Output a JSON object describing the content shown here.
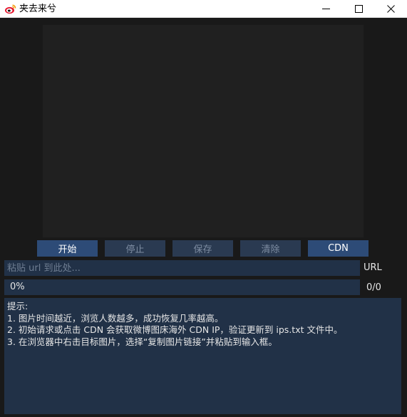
{
  "window": {
    "title": "夹去来兮",
    "icon": "weibo-logo-icon",
    "controls": {
      "minimize": "minimize-icon",
      "maximize": "maximize-icon",
      "close": "close-icon"
    }
  },
  "buttons": {
    "start": "开始",
    "stop": "停止",
    "save": "保存",
    "clear": "清除",
    "cdn": "CDN"
  },
  "url_input": {
    "value": "",
    "placeholder": "粘贴 url 到此处...",
    "label": "URL"
  },
  "progress": {
    "percent_text": "0%",
    "fraction": 0,
    "count": "0/0"
  },
  "tips": {
    "heading": "提示:",
    "lines": [
      "1. 图片时间越近，浏览人数越多，成功恢复几率越高。",
      "2. 初始请求或点击 CDN 会获取微博图床海外 CDN IP，验证更新到 ips.txt 文件中。",
      "3. 在浏览器中右击目标图片，选择“复制图片链接”并粘贴到输入框。"
    ]
  },
  "colors": {
    "background": "#191919",
    "panel": "#213147",
    "button_active": "#2d4b77",
    "button_inactive": "#2a3a51"
  }
}
